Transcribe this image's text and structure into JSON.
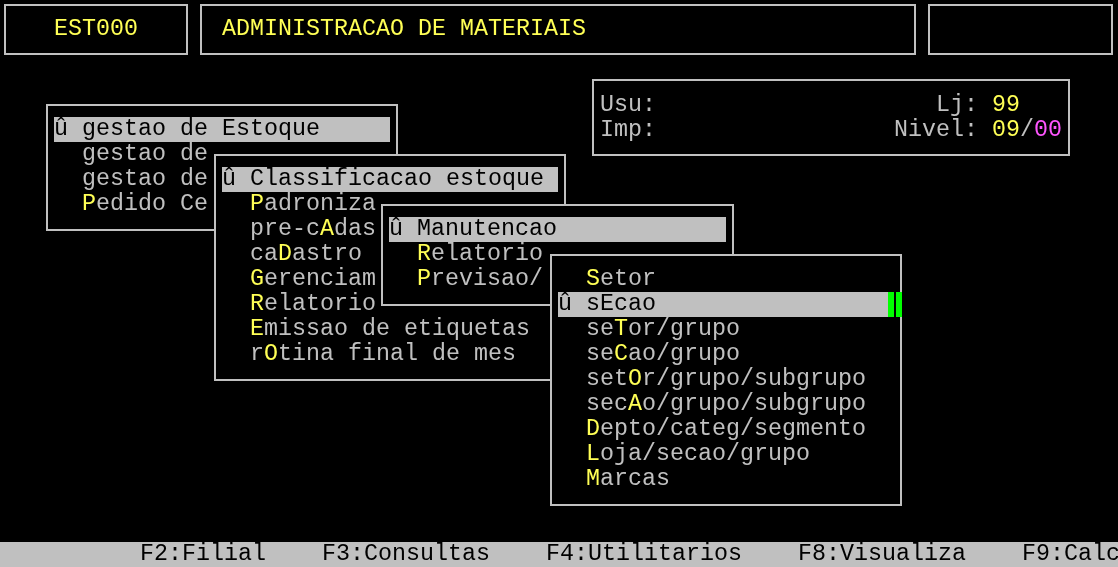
{
  "header": {
    "program_code": "EST000",
    "title": "ADMINISTRACAO DE MATERIAIS"
  },
  "info": {
    "user_label": "Usu:",
    "printer_label": "Imp:",
    "store_label": "Lj:",
    "store": "99",
    "nivel_label": "Nivel:",
    "nivel_value": "09",
    "nivel_separator": "/",
    "nivel_sub": "00"
  },
  "menus": [
    {
      "selection_mark": "û",
      "items": [
        {
          "label": "gestao de Estoque",
          "selected": true
        },
        {
          "label": "gestao de",
          "selected": false
        },
        {
          "label": "gestao de",
          "selected": false
        },
        {
          "label": "**P**edido Ce",
          "selected": false
        }
      ]
    },
    {
      "selection_mark": "û",
      "items": [
        {
          "label": "Classificacao estoque",
          "selected": true
        },
        {
          "label": "**P**adroniza",
          "selected": false
        },
        {
          "label": "pre-c**A**das",
          "selected": false
        },
        {
          "label": "ca**D**astro",
          "selected": false
        },
        {
          "label": "**G**erenciam",
          "selected": false
        },
        {
          "label": "**R**elatorio",
          "selected": false
        },
        {
          "label": "**E**missao de etiquetas",
          "selected": false
        },
        {
          "label": "r**O**tina final de mes",
          "selected": false
        }
      ]
    },
    {
      "selection_mark": "û",
      "items": [
        {
          "label": "Manutencao",
          "selected": true
        },
        {
          "label": "**R**elatorio",
          "selected": false
        },
        {
          "label": "**P**revisao/",
          "selected": false
        }
      ]
    },
    {
      "selection_mark": "û",
      "items": [
        {
          "label": "**S**etor",
          "selected": false
        },
        {
          "label": "sEcao",
          "selected": true
        },
        {
          "label": "se**T**or/grupo",
          "selected": false
        },
        {
          "label": "se**C**ao/grupo",
          "selected": false
        },
        {
          "label": "set**O**r/grupo/subgrupo",
          "selected": false
        },
        {
          "label": "sec**A**o/grupo/subgrupo",
          "selected": false
        },
        {
          "label": "**D**epto/categ/segmento",
          "selected": false
        },
        {
          "label": "**L**oja/secao/grupo",
          "selected": false
        },
        {
          "label": "**M**arcas",
          "selected": false
        }
      ]
    }
  ],
  "function_keys": [
    "F2:Filial",
    "F3:Consultas",
    "F4:Utilitarios",
    "F8:Visualiza",
    "F9:Calc"
  ]
}
